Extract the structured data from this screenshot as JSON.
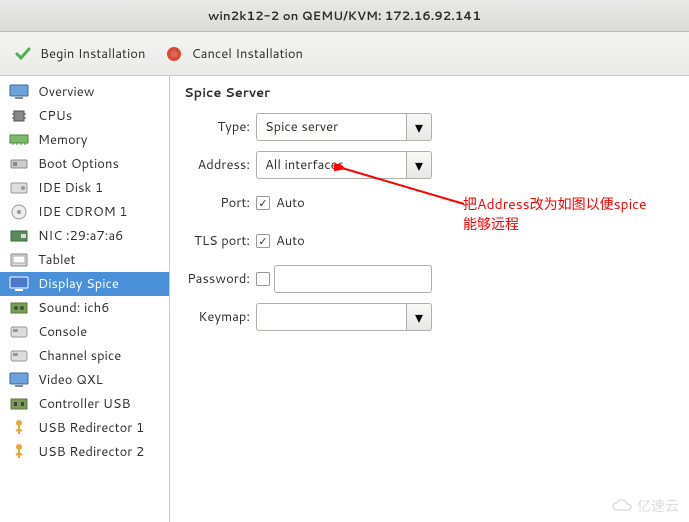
{
  "window": {
    "title": "win2k12-2 on QEMU/KVM: 172.16.92.141"
  },
  "toolbar": {
    "begin": "Begin Installation",
    "cancel": "Cancel Installation"
  },
  "sidebar": {
    "items": [
      {
        "label": "Overview"
      },
      {
        "label": "CPUs"
      },
      {
        "label": "Memory"
      },
      {
        "label": "Boot Options"
      },
      {
        "label": "IDE Disk 1"
      },
      {
        "label": "IDE CDROM 1"
      },
      {
        "label": "NIC :29:a7:a6"
      },
      {
        "label": "Tablet"
      },
      {
        "label": "Display Spice"
      },
      {
        "label": "Sound: ich6"
      },
      {
        "label": "Console"
      },
      {
        "label": "Channel spice"
      },
      {
        "label": "Video QXL"
      },
      {
        "label": "Controller USB"
      },
      {
        "label": "USB Redirector 1"
      },
      {
        "label": "USB Redirector 2"
      }
    ]
  },
  "form": {
    "section": "Spice Server",
    "type_label": "Type:",
    "type_value": "Spice server",
    "address_label": "Address:",
    "address_value": "All interfaces",
    "port_label": "Port:",
    "port_auto": "Auto",
    "port_checked": true,
    "tls_label": "TLS port:",
    "tls_auto": "Auto",
    "tls_checked": true,
    "password_label": "Password:",
    "password_checked": false,
    "keymap_label": "Keymap:",
    "keymap_value": ""
  },
  "annotation": {
    "line1": "把Address改为如图以便spice",
    "line2": "能够远程"
  },
  "watermark": "亿速云"
}
